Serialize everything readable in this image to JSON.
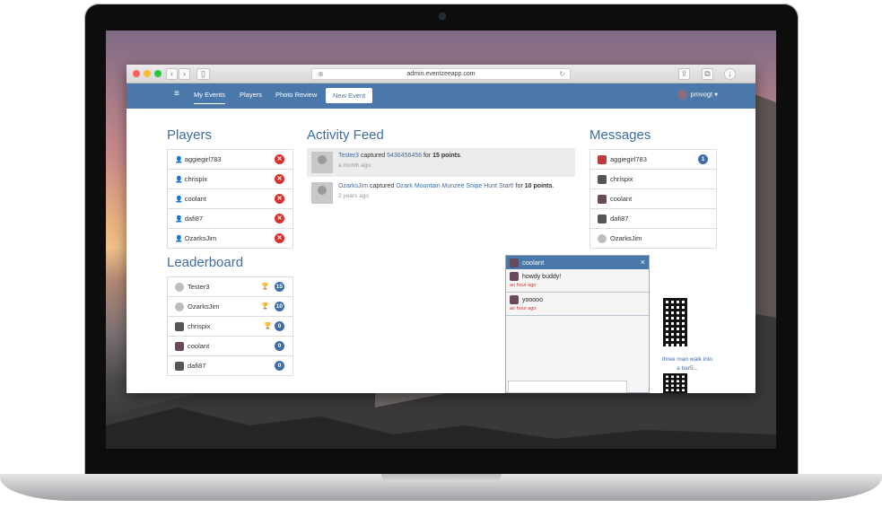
{
  "browser": {
    "url": "admin.eventzeeapp.com"
  },
  "navbar": {
    "menu_icon": "hamburger-icon",
    "items": [
      "My Events",
      "Players",
      "Photo Review"
    ],
    "new_event": "New Event",
    "user": "pmvogt ▾"
  },
  "players": {
    "title": "Players",
    "items": [
      "aggiegirl783",
      "chrispix",
      "coolant",
      "dafi87",
      "OzarksJim"
    ]
  },
  "leaderboard": {
    "title": "Leaderboard",
    "items": [
      {
        "name": "Tester3",
        "score": "15",
        "trophy": "gold"
      },
      {
        "name": "OzarksJim",
        "score": "10",
        "trophy": "silver"
      },
      {
        "name": "chrispix",
        "score": "0",
        "trophy": "bronze"
      },
      {
        "name": "coolant",
        "score": "0"
      },
      {
        "name": "dafi87",
        "score": "0"
      }
    ]
  },
  "feed": {
    "title": "Activity Feed",
    "items": [
      {
        "user": "Tester3",
        "verb": " captured ",
        "target": "5436456456",
        "pre": " for ",
        "points": "15 points",
        "post": ".",
        "time": "a month ago"
      },
      {
        "user": "OzarksJim",
        "verb": " captured ",
        "target": "Ozark Mountain Munzee Snipe Hunt Start!",
        "pre": " for ",
        "points": "10 points",
        "post": ".",
        "time": "2 years ago"
      }
    ]
  },
  "messages": {
    "title": "Messages",
    "items": [
      {
        "name": "aggiegirl783",
        "badge": "1"
      },
      {
        "name": "chrispix"
      },
      {
        "name": "coolant"
      },
      {
        "name": "dafi87"
      },
      {
        "name": "OzarksJim"
      }
    ]
  },
  "chat": {
    "user": "coolant",
    "close": "×",
    "messages": [
      {
        "text": "howdy buddy!",
        "time": "an hour ago"
      },
      {
        "text": "yooooo",
        "time": "an hour ago"
      }
    ]
  },
  "qr": {
    "caption": "three man walk into a bar5..."
  }
}
